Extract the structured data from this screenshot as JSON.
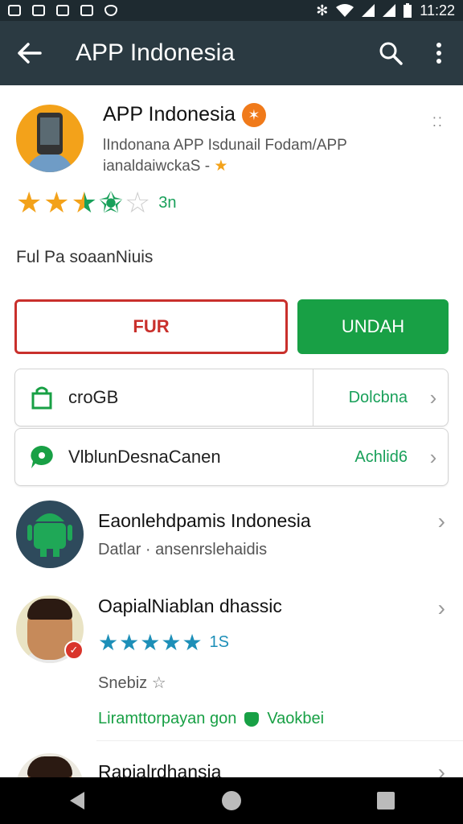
{
  "status_bar": {
    "time": "11:22",
    "left_icons": [
      "notification-icon",
      "notification-icon",
      "image-icon",
      "eye-icon",
      "shield-icon"
    ],
    "right_icons": [
      "bluetooth-icon",
      "wifi-icon",
      "signal-icon",
      "signal-icon",
      "battery-icon"
    ]
  },
  "app_bar": {
    "title": "APP Indonesia",
    "icons": [
      "back-arrow-icon",
      "search-icon",
      "more-vert-icon"
    ]
  },
  "app": {
    "name": "APP Indonesia",
    "badge": "✶",
    "subtitle_line1": "lIndonana APP Isdunail Fodam/APP",
    "subtitle_line2": "ianaldaiwckaS -",
    "rating_stars": 3.5,
    "rating_count": "3n",
    "description": "Ful Pa soaanNiuis"
  },
  "buttons": {
    "primary_outline": "FUR",
    "primary_fill": "UNDAH"
  },
  "cards": [
    {
      "label": "croGB",
      "value": "Dolcbna",
      "icon": "shopping-bag-icon"
    },
    {
      "label": "VlblunDesnaCanen",
      "value": "Achlid6",
      "icon": "chat-bubble-icon"
    }
  ],
  "list": [
    {
      "title": "Eaonlehdpamis Indonesia",
      "sub": "Datlar  ·  ansenrslehaidis",
      "avatar": "android-icon"
    },
    {
      "title": "OapialNiablan dhassic",
      "rating_count": "1S",
      "rating_stars": 5,
      "sub": "Snebiz",
      "footer": "Liramttorpayan gon",
      "footer_tag": "Vaokbei",
      "avatar": "person-avatar"
    },
    {
      "title": "Rapialrdhansia",
      "avatar": "person-avatar"
    }
  ],
  "colors": {
    "appbar": "#2b3a42",
    "green": "#18a045",
    "red": "#c9302c",
    "star": "#f3a21a",
    "star_green": "#19a05a",
    "star_blue": "#1d8fb8"
  }
}
